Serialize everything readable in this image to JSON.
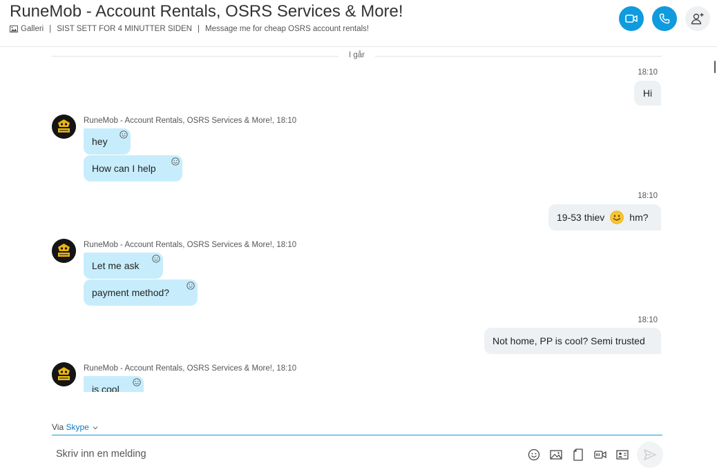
{
  "header": {
    "title": "RuneMob - Account Rentals, OSRS Services & More!",
    "gallery_label": "Galleri",
    "separator": "|",
    "last_seen": "SIST SETT FOR 4 MINUTTER SIDEN",
    "mood": "Message me for cheap OSRS account rentals!",
    "icons": {
      "video": "video-call-icon",
      "call": "phone-call-icon",
      "add": "add-person-icon"
    },
    "accent_color": "#0f9bde"
  },
  "chat": {
    "day_label": "I går",
    "sender_name": "RuneMob - Account Rentals, OSRS Services & More!,",
    "messages": [
      {
        "direction": "out",
        "time": "18:10",
        "text": "Hi"
      },
      {
        "direction": "in",
        "time": "18:10",
        "text": "hey"
      },
      {
        "direction": "in",
        "text": "How can I help"
      },
      {
        "direction": "out",
        "time": "18:10",
        "text_before": "19-53 thiev",
        "text_after": "hm?"
      },
      {
        "direction": "in",
        "time": "18:10",
        "text": "Let me ask"
      },
      {
        "direction": "in",
        "text": "payment method?"
      },
      {
        "direction": "out",
        "time": "18:10",
        "text": "Not home, PP is cool? Semi trusted"
      },
      {
        "direction": "in",
        "time": "18:10",
        "text": "is cool"
      }
    ],
    "incoming_bubble_color": "#c7edfc",
    "outgoing_bubble_color": "#eef1f4"
  },
  "composer": {
    "via_label": "Via",
    "via_link": "Skype",
    "placeholder": "Skriv inn en melding",
    "tools": [
      "emoji-icon",
      "image-icon",
      "file-icon",
      "video-message-icon",
      "contact-card-icon"
    ],
    "send_icon": "send-icon"
  }
}
